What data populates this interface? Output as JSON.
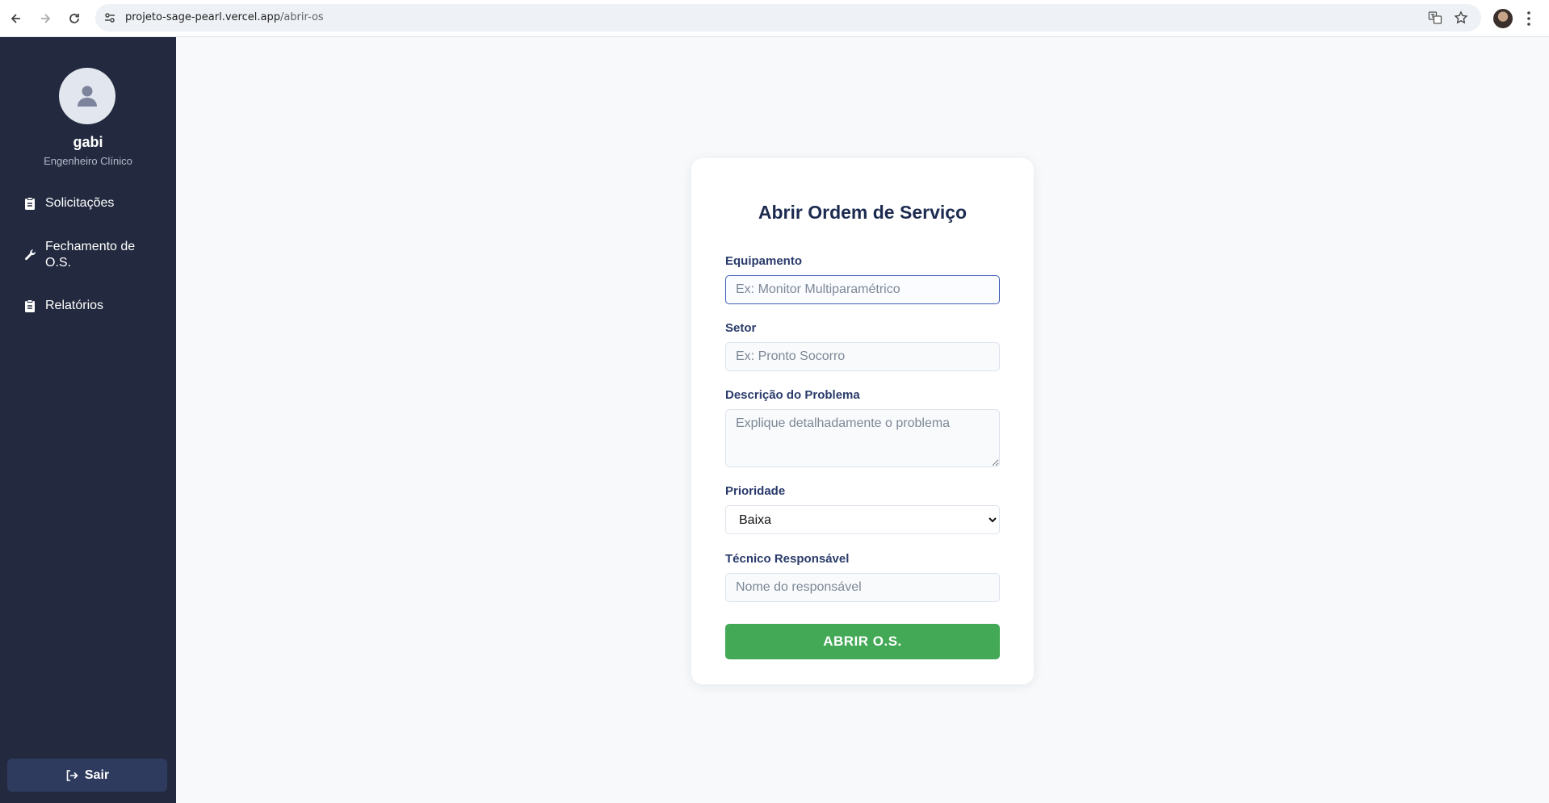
{
  "browser": {
    "url_host": "projeto-sage-pearl.vercel.app",
    "url_path": "/abrir-os"
  },
  "sidebar": {
    "user_name": "gabi",
    "user_role": "Engenheiro Clínico",
    "items": [
      {
        "label": "Solicitações",
        "icon": "clipboard-icon"
      },
      {
        "label": "Fechamento de O.S.",
        "icon": "wrench-icon"
      },
      {
        "label": "Relatórios",
        "icon": "clipboard-icon"
      }
    ],
    "logout_label": "Sair"
  },
  "form": {
    "title": "Abrir Ordem de Serviço",
    "equipamento": {
      "label": "Equipamento",
      "placeholder": "Ex: Monitor Multiparamétrico",
      "value": ""
    },
    "setor": {
      "label": "Setor",
      "placeholder": "Ex: Pronto Socorro",
      "value": ""
    },
    "descricao": {
      "label": "Descrição do Problema",
      "placeholder": "Explique detalhadamente o problema",
      "value": ""
    },
    "prioridade": {
      "label": "Prioridade",
      "selected": "Baixa"
    },
    "tecnico": {
      "label": "Técnico Responsável",
      "placeholder": "Nome do responsável",
      "value": ""
    },
    "submit_label": "ABRIR O.S."
  },
  "colors": {
    "sidebar_bg": "#232a3f",
    "title": "#1d2b50",
    "submit": "#43a956",
    "logout_bg": "#2e3a5e"
  }
}
